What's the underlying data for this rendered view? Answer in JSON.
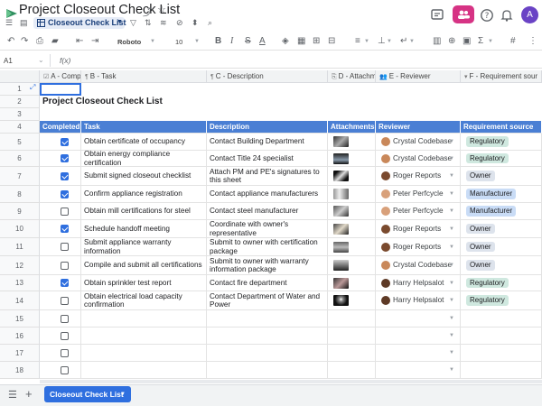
{
  "app": {
    "title": "Project Closeout Check List",
    "avatar_letter": "A",
    "sheet_tab": "Closeout Check List"
  },
  "toolbar": {
    "font": "Roboto",
    "font_size": "10",
    "bold": "B",
    "italic": "I",
    "strike": "S",
    "text_color": "A",
    "more": "#"
  },
  "formula_bar": {
    "cell_ref": "A1",
    "fx": "f(x)"
  },
  "columns": [
    {
      "label": "A - Comp"
    },
    {
      "label": "B - Task"
    },
    {
      "label": "C - Description"
    },
    {
      "label": "D - Attachm"
    },
    {
      "label": "E - Reviewer"
    },
    {
      "label": "F - Requirement sour"
    }
  ],
  "sheet_title": "Project Closeout Check List",
  "table_headers": [
    "Completed",
    "Task",
    "Description",
    "Attachments",
    "Reviewer",
    "Requirement source"
  ],
  "rows": [
    {
      "num": "5",
      "completed": true,
      "task": "Obtain certificate of occupancy",
      "desc": "Contact Building Department",
      "reviewer": "Crystal Codebase",
      "source": "Regulatory"
    },
    {
      "num": "6",
      "completed": true,
      "task": "Obtain energy compliance certification",
      "desc": "Contact Title 24 specialist",
      "reviewer": "Crystal Codebase",
      "source": "Regulatory"
    },
    {
      "num": "7",
      "completed": true,
      "task": "Submit signed closeout checklist",
      "desc": "Attach PM and PE's signatures to this sheet",
      "reviewer": "Roger Reports",
      "source": "Owner"
    },
    {
      "num": "8",
      "completed": true,
      "task": "Confirm appliance registration",
      "desc": "Contact appliance manufacturers",
      "reviewer": "Peter Perfcycle",
      "source": "Manufacturer"
    },
    {
      "num": "9",
      "completed": false,
      "task": "Obtain mill certifications for steel",
      "desc": "Contact steel manufacturer",
      "reviewer": "Peter Perfcycle",
      "source": "Manufacturer"
    },
    {
      "num": "10",
      "completed": true,
      "task": "Schedule handoff meeting",
      "desc": "Coordinate with owner's representative",
      "reviewer": "Roger Reports",
      "source": "Owner"
    },
    {
      "num": "11",
      "completed": false,
      "task": "Submit appliance warranty information",
      "desc": "Submit to owner with certification package",
      "reviewer": "Roger Reports",
      "source": "Owner"
    },
    {
      "num": "12",
      "completed": false,
      "task": "Compile and submit all certifications",
      "desc": "Submit to owner with warranty information package",
      "reviewer": "Crystal Codebase",
      "source": "Owner"
    },
    {
      "num": "13",
      "completed": true,
      "task": "Obtain sprinkler test report",
      "desc": "Contact fire department",
      "reviewer": "Harry Helpsalot",
      "source": "Regulatory"
    },
    {
      "num": "14",
      "completed": false,
      "task": "Obtain electrical load capacity confirmation",
      "desc": "Contact Department of Water and Power",
      "reviewer": "Harry Helpsalot",
      "source": "Regulatory"
    }
  ],
  "empty_rows": [
    "15",
    "16",
    "17",
    "18"
  ],
  "top_rows": [
    "1",
    "2",
    "3",
    "4"
  ],
  "colors": {
    "header_blue": "#4a7fd4",
    "regulatory": "#cfe8df",
    "owner": "#dde3ec",
    "manufacturer": "#c9dcf6",
    "share_pink": "#d63384",
    "avatar_purple": "#6a43c5"
  }
}
